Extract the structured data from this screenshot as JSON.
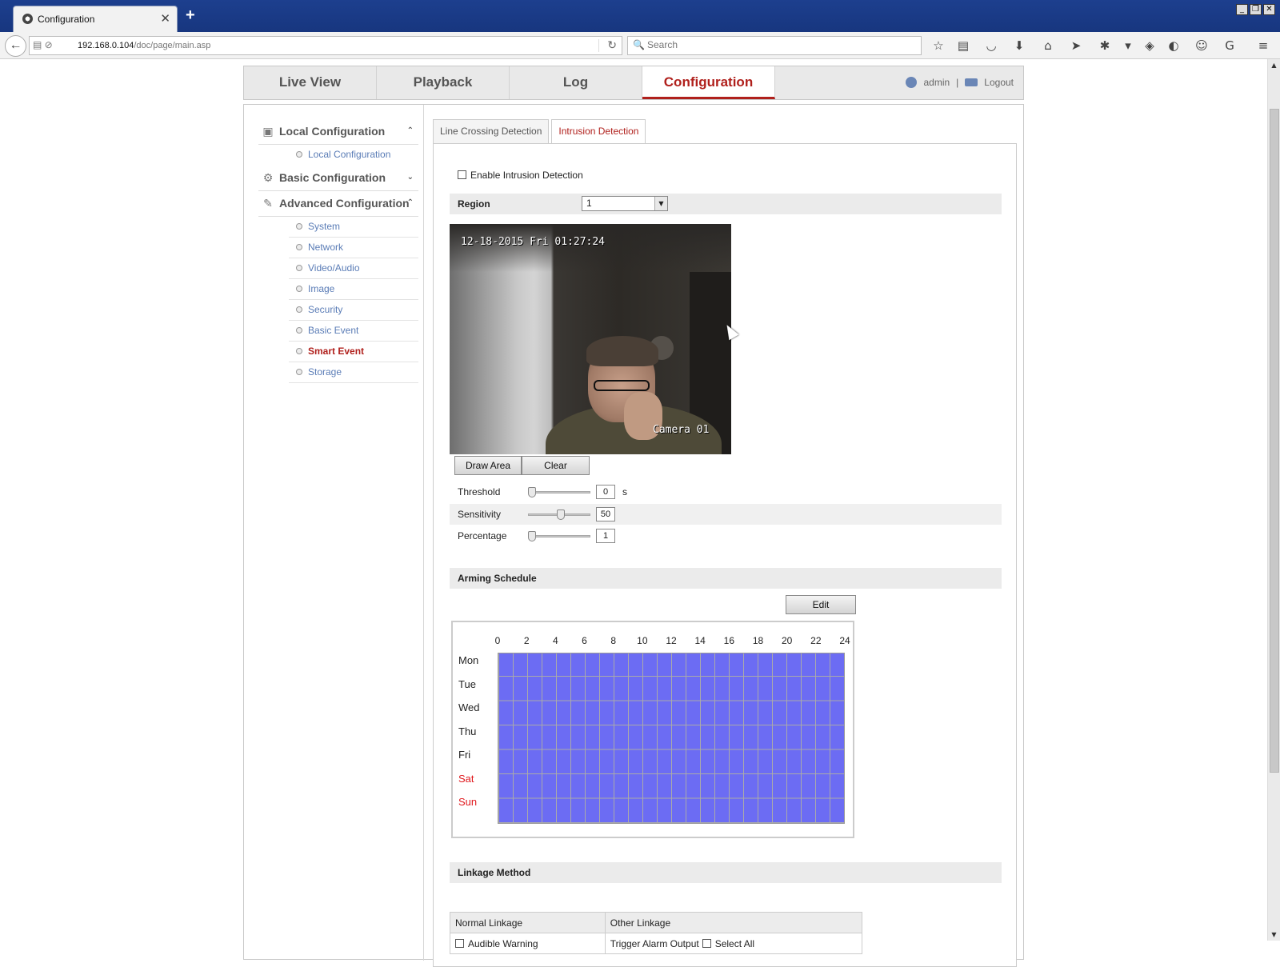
{
  "browser": {
    "tab_title": "Configuration",
    "url_host": "192.168.0.104",
    "url_path": "/doc/page/main.asp",
    "search_placeholder": "Search"
  },
  "topmenu": {
    "items": [
      {
        "label": "Live View"
      },
      {
        "label": "Playback"
      },
      {
        "label": "Log"
      },
      {
        "label": "Configuration",
        "active": true
      }
    ],
    "user": "admin",
    "separator": "|",
    "logout": "Logout"
  },
  "sidebar": {
    "local": {
      "title": "Local Configuration",
      "items": [
        "Local Configuration"
      ]
    },
    "basic": {
      "title": "Basic Configuration"
    },
    "advanced": {
      "title": "Advanced Configuration",
      "items": [
        "System",
        "Network",
        "Video/Audio",
        "Image",
        "Security",
        "Basic Event",
        "Smart Event",
        "Storage"
      ],
      "active": "Smart Event"
    }
  },
  "tabs": [
    "Line Crossing Detection",
    "Intrusion Detection"
  ],
  "form": {
    "enable_label": "Enable Intrusion Detection",
    "enable_checked": false,
    "region_label": "Region",
    "region_value": "1",
    "video_timestamp": "12-18-2015 Fri 01:27:24",
    "video_camera": "Camera 01",
    "draw_area": "Draw Area",
    "clear": "Clear",
    "threshold_label": "Threshold",
    "threshold_value": "0",
    "threshold_unit": "s",
    "threshold_level": 0,
    "sensitivity_label": "Sensitivity",
    "sensitivity_value": "50",
    "sensitivity_level": 0.5,
    "percentage_label": "Percentage",
    "percentage_value": "1",
    "percentage_level": 0
  },
  "schedule": {
    "title": "Arming Schedule",
    "edit": "Edit",
    "hours": [
      "0",
      "2",
      "4",
      "6",
      "8",
      "10",
      "12",
      "14",
      "16",
      "18",
      "20",
      "22",
      "24"
    ],
    "days": [
      "Mon",
      "Tue",
      "Wed",
      "Thu",
      "Fri",
      "Sat",
      "Sun"
    ],
    "fill_color": "#6c6cf3"
  },
  "linkage": {
    "title": "Linkage Method",
    "normal": "Normal Linkage",
    "other": "Other Linkage",
    "audible": "Audible Warning",
    "trigger": "Trigger Alarm Output",
    "select_all": "Select All"
  }
}
